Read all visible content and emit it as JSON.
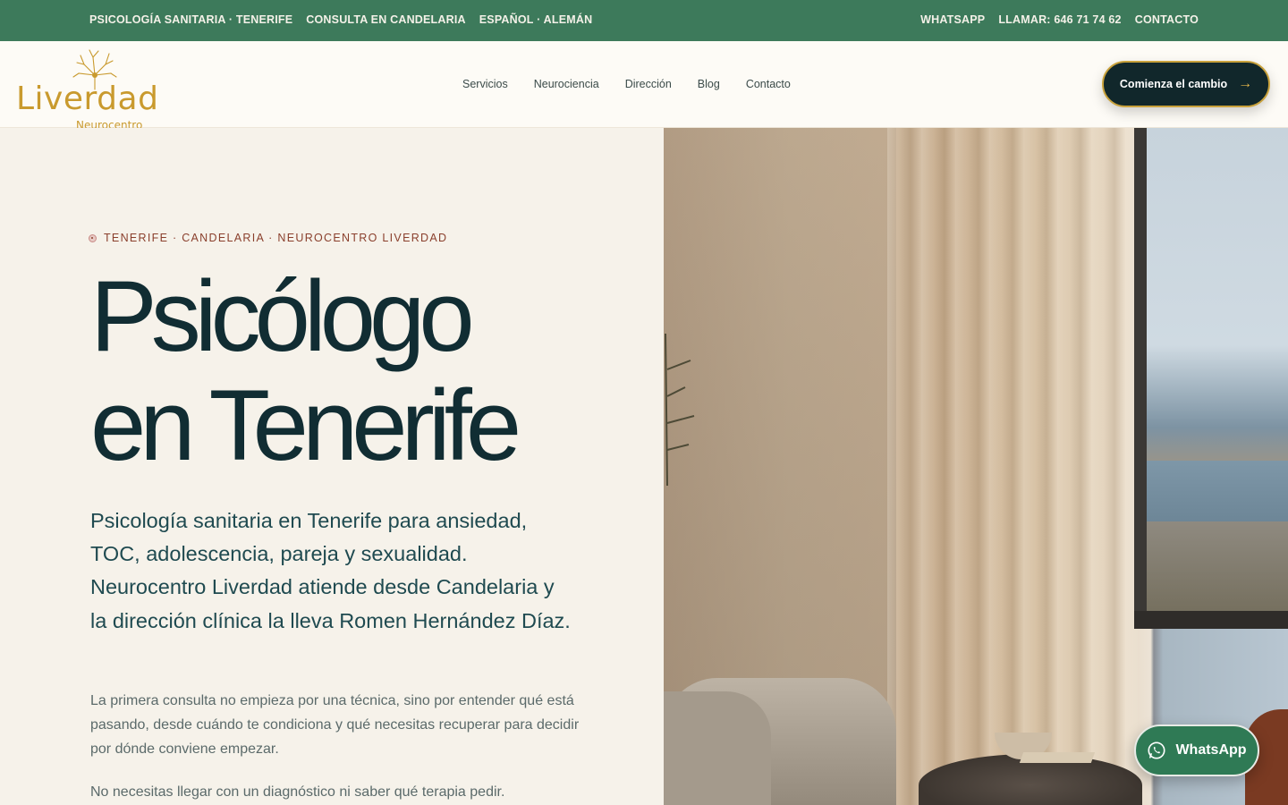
{
  "topbar": {
    "left": [
      "PSICOLOGÍA SANITARIA · TENERIFE",
      "CONSULTA EN CANDELARIA",
      "ESPAÑOL · ALEMÁN"
    ],
    "right": {
      "whatsapp": "WHATSAPP",
      "call": "LLAMAR: 646 71 74 62",
      "contact": "CONTACTO"
    }
  },
  "header": {
    "logo": {
      "name": "Liverdad",
      "sub": "Neurocentro"
    },
    "nav": [
      "Servicios",
      "Neurociencia",
      "Dirección",
      "Blog",
      "Contacto"
    ],
    "cta": {
      "label": "Comienza el cambio",
      "icon": "arrow-right-icon"
    }
  },
  "hero": {
    "eyebrow": "TENERIFE · CANDELARIA · NEUROCENTRO LIVERDAD",
    "title_line1": "Psicólogo",
    "title_line2": "en Tenerife",
    "lead": "Psicología sanitaria en Tenerife para ansiedad, TOC, adolescencia, pareja y sexualidad. Neurocentro Liverdad atiende desde Candelaria y la dirección clínica la lleva Romen Hernández Díaz.",
    "paragraph1": "La primera consulta no empieza por una técnica, sino por entender qué está pasando, desde cuándo te condiciona y qué necesitas recuperar para decidir por dónde conviene empezar.",
    "paragraph2": "No necesitas llegar con un diagnóstico ni saber qué terapia pedir."
  },
  "floating": {
    "whatsapp_label": "WhatsApp",
    "icon": "whatsapp-icon"
  },
  "colors": {
    "topbar": "#3d7a5b",
    "cta_bg": "#11272b",
    "accent_gold": "#c99a2e",
    "eyebrow": "#8a3f2c",
    "title": "#112d33"
  }
}
